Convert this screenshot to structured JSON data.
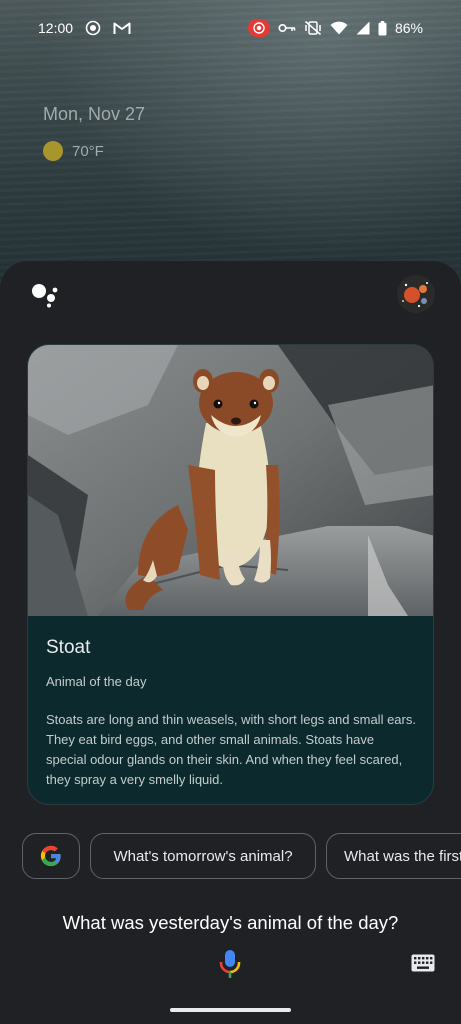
{
  "status_bar": {
    "time": "12:00",
    "battery": "86%"
  },
  "lockscreen": {
    "date": "Mon, Nov 27",
    "temperature": "70°F"
  },
  "card": {
    "title": "Stoat",
    "subtitle": "Animal of the day",
    "description": "Stoats are long and thin weasels, with short legs and small ears. They eat bird eggs, and other small animals. Stoats have special odour glands on their skin. And when they feel scared, they spray a very smelly liquid."
  },
  "chips": {
    "google_icon": "google-g-icon",
    "suggestion_1": "What's tomorrow's animal?",
    "suggestion_2": "What was the first"
  },
  "query": "What was yesterday's animal of the day?",
  "colors": {
    "card_bg": "#0c2a2e",
    "sheet_bg": "#202124",
    "record_red": "#e53935"
  }
}
